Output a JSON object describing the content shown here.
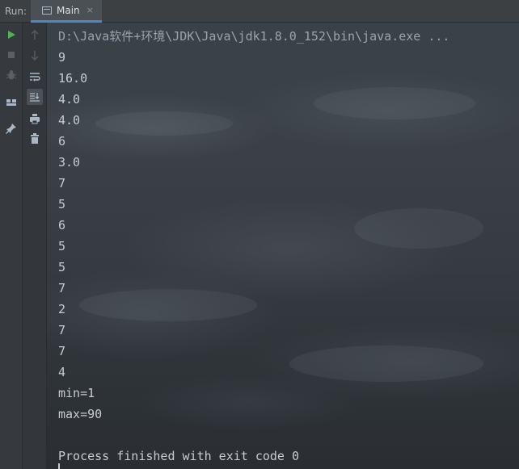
{
  "header": {
    "run_label": "Run:",
    "tab_label": "Main",
    "tab_close": "×"
  },
  "toolbar_left": [
    "rerun-icon",
    "stop-icon",
    "debug-icon",
    "layout-icon",
    "pin-icon"
  ],
  "toolbar_second": [
    "up-arrow-icon",
    "down-arrow-icon",
    "soft-wrap-icon",
    "scroll-to-end-icon",
    "print-icon",
    "trash-icon"
  ],
  "console": {
    "command": "D:\\Java软件+环境\\JDK\\Java\\jdk1.8.0_152\\bin\\java.exe ...",
    "lines": [
      "9",
      "16.0",
      "4.0",
      "4.0",
      "6",
      "3.0",
      "7",
      "5",
      "6",
      "5",
      "5",
      "7",
      "2",
      "7",
      "7",
      "4",
      "min=1",
      "max=90"
    ],
    "exit_message": "Process finished with exit code 0"
  },
  "colors": {
    "run_green": "#4fb34f",
    "tab_underline": "#4a88c7",
    "text": "#c8ccd0"
  }
}
